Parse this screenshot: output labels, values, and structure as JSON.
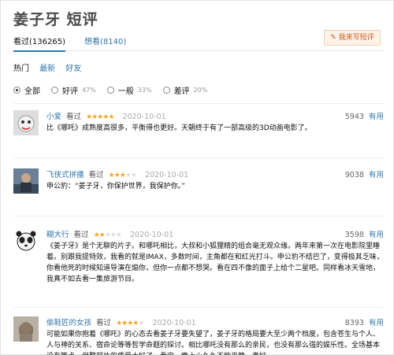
{
  "page": {
    "title": "姜子牙 短评"
  },
  "tabs": [
    {
      "label": "看过(136265)"
    },
    {
      "label": "想看(8140)"
    }
  ],
  "write_button": {
    "label": "我来写短评"
  },
  "sort": [
    {
      "label": "热门"
    },
    {
      "label": "最新"
    },
    {
      "label": "好友"
    }
  ],
  "filters": [
    {
      "label": "全部",
      "pct": ""
    },
    {
      "label": "好评",
      "pct": "47%"
    },
    {
      "label": "一般",
      "pct": "33%"
    },
    {
      "label": "差评",
      "pct": "20%"
    }
  ],
  "seen_label": "看过",
  "useful_label": "有用",
  "reviews": [
    {
      "user": "小爱",
      "rating": 5,
      "date": "2020-10-01",
      "votes": "5943",
      "content": "比《哪吒》成熟度高很多，平衡得也更好。天朝终于有了一部高级的3D动画电影了。"
    },
    {
      "user": "飞侠式拼播",
      "rating": 3,
      "date": "2020-10-01",
      "votes": "9038",
      "content": "申公豹：“姜子牙，你保护世界，我保护你。”"
    },
    {
      "user": "糊大行",
      "rating": 2,
      "date": "2020-10-01",
      "votes": "3598",
      "content": "《姜子牙》是个无聊的片子。和哪吒相比，大叔和小狐狸精的组合毫无观众缘。两年来第一次在电影院里睡着。别跟我提特效，我看的就是IMAX，多数时间，主角都在和红光打斗。申公豹不结巴了，变得极其乏味，你看他死的时候知道导演在煽你，但你一点都不想哭。看在四不像的面子上给个二星吧。同样看冰天雪地，我真不如去看一集旅游节目。"
    },
    {
      "user": "偷鞋匠的女孩",
      "rating": 4,
      "date": "2020-10-01",
      "votes": "8393",
      "content": "可能如果你抱着《哪吒》的心态去看姜子牙要失望了，姜子牙的格局要大至少两个档度，包含苍生与个人、人与神的关系、宿命论等等哲学命题的探讨。相比哪吒没有那么的亲民，也没有那么强的娱乐性。全场基本没有笑点。但整部片的质量太好了，看完一晚上心久久不能平静，真好。"
    }
  ]
}
